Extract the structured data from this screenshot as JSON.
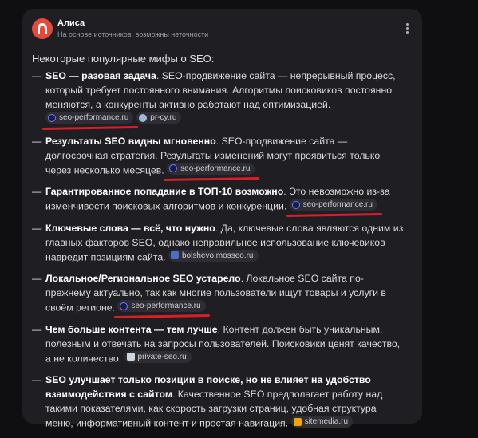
{
  "header": {
    "title": "Алиса",
    "subtitle": "На основе источников, возможны неточности"
  },
  "intro": "Некоторые популярные мифы о SEO:",
  "myths": [
    {
      "bold": "SEO — разовая задача",
      "text": ". SEO-продвижение сайта — непрерывный процесс, который требует постоянного внимания. Алгоритмы поисковиков постоянно меняются, а конкуренты активно работают над оптимизацией.",
      "sources": [
        {
          "label": "seo-performance.ru",
          "icon": "seo-performance-favicon"
        },
        {
          "label": "pr-cy.ru",
          "icon": "pr-cy-favicon"
        }
      ]
    },
    {
      "bold": "Результаты SEO видны мгновенно",
      "text": ". SEO-продвижение сайта — долгосрочная стратегия. Результаты изменений могут проявиться только через несколько месяцев.",
      "sources": [
        {
          "label": "seo-performance.ru",
          "icon": "seo-performance-favicon"
        }
      ]
    },
    {
      "bold": "Гарантированное попадание в ТОП-10 возможно",
      "text": ". Это невозможно из-за изменчивости поисковых алгоритмов и конкуренции.",
      "sources": [
        {
          "label": "seo-performance.ru",
          "icon": "seo-performance-favicon"
        }
      ]
    },
    {
      "bold": "Ключевые слова — всё, что нужно",
      "text": ". Да, ключевые слова являются одним из главных факторов SEO, однако неправильное использование ключевиков навредит позициям сайта.",
      "sources": [
        {
          "label": "bolshevo.mosseo.ru",
          "icon": "bolshevo-favicon"
        }
      ]
    },
    {
      "bold": "Локальное/Региональное SEO устарело",
      "text": ". Локальное SEO сайта по-прежнему актуально, так как многие пользователи ищут товары и услуги в своём регионе.",
      "sources": [
        {
          "label": "seo-performance.ru",
          "icon": "seo-performance-favicon"
        }
      ]
    },
    {
      "bold": "Чем больше контента — тем лучше",
      "text": ". Контент должен быть уникальным, полезным и отвечать на запросы пользователей. Поисковики ценят качество, а не количество.",
      "sources": [
        {
          "label": "private-seo.ru",
          "icon": "private-seo-favicon"
        }
      ]
    },
    {
      "bold": "SEO улучшает только позиции в поиске, но не влияет на удобство взаимодействия с сайтом",
      "text": ". Качественное SEO предполагает работу над такими показателями, как скорость загрузки страниц, удобная структура меню, информативный контент и простая навигация.",
      "sources": [
        {
          "label": "sitemedia.ru",
          "icon": "sitemedia-favicon"
        }
      ]
    }
  ],
  "colors": {
    "background": "#0f0f11",
    "card": "#1f1f23",
    "avatar": "#e8483a",
    "annotation_underline": "#d61f26"
  }
}
